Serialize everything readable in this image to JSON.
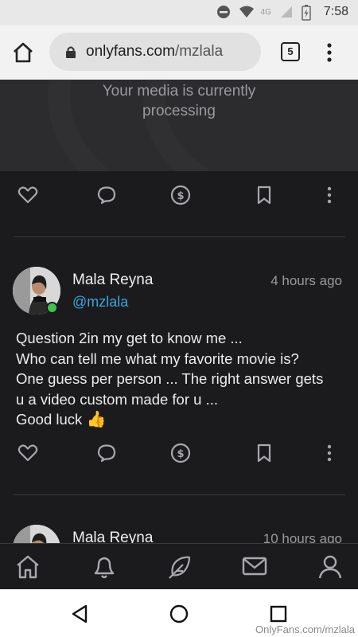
{
  "status_bar": {
    "time": "7:58",
    "network_label": "4G"
  },
  "browser": {
    "url_domain": "onlyfans.com",
    "url_path": "/mzlala",
    "tab_count": "5"
  },
  "media_card": {
    "message_line1": "Your media is currently",
    "message_line2": "processing"
  },
  "posts": [
    {
      "author": "Mala Reyna",
      "handle": "@mzlala",
      "time_ago": "4 hours ago",
      "online": true,
      "text_lines": [
        "Question 2in my get to know me ...",
        "Who can tell me what my favorite movie is?",
        "One guess per person ... The right answer gets",
        "u a video custom made for u ...",
        "Good luck"
      ],
      "emoji": "👍"
    },
    {
      "author": "Mala Reyna",
      "time_ago": "10 hours ago"
    }
  ],
  "bottom_tabs": [
    "home-icon",
    "bell-icon",
    "feather-icon",
    "message-icon",
    "profile-icon"
  ],
  "watermark": "OnlyFans.com/mzlala",
  "colors": {
    "background": "#1b1b1d",
    "handle_blue": "#3aa5e0",
    "online_green": "#3ec44a",
    "icon_gray": "#a8a8ad"
  }
}
